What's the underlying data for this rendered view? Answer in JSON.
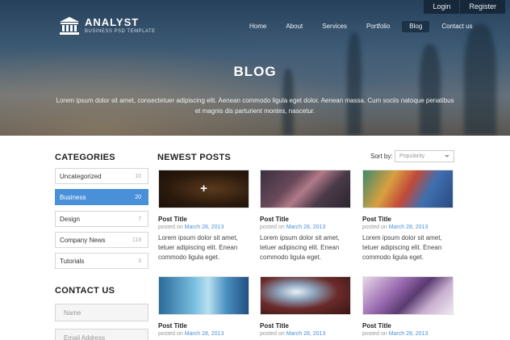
{
  "header": {
    "logo_title": "ANALYST",
    "logo_subtitle": "BUSINESS PSD TEMPLATE",
    "account_links": [
      "Login",
      "Register"
    ],
    "nav": [
      "Home",
      "About",
      "Services",
      "Portfolio",
      "Blog",
      "Contact us"
    ],
    "nav_active": "Blog",
    "hero_title": "BLOG",
    "hero_description": "Lorem ipsum dolor sit amet, consectetuer adipiscing elit. Aenean commodo ligula eget dolor. Aenean massa. Cum sociis natoque penatibus et magnis dis parturient montes, nascetur."
  },
  "sidebar": {
    "categories_heading": "CATEGORIES",
    "categories": [
      {
        "label": "Uncategorized",
        "count": "10",
        "active": false
      },
      {
        "label": "Business",
        "count": "20",
        "active": true
      },
      {
        "label": "Design",
        "count": "7",
        "active": false
      },
      {
        "label": "Company News",
        "count": "119",
        "active": false
      },
      {
        "label": "Tutorials",
        "count": "3",
        "active": false
      }
    ],
    "contact_heading": "CONTACT US",
    "contact_fields": [
      {
        "placeholder": "Name"
      },
      {
        "placeholder": "Email Address"
      }
    ]
  },
  "main": {
    "heading": "NEWEST POSTS",
    "sort_label": "Sort by:",
    "sort_value": "Popularity",
    "posts": [
      {
        "title": "Post Title",
        "meta_prefix": "posted on",
        "date": "March 28, 2013",
        "excerpt": "Lorem ipsum dolor sit amet, tetuer adipiscing elit. Enean commodo ligula eget.",
        "hover_icon": "+"
      },
      {
        "title": "Post Title",
        "meta_prefix": "posted on",
        "date": "March 28, 2013",
        "excerpt": "Lorem ipsum dolor sit amet, tetuer adipiscing elit. Enean commodo ligula eget."
      },
      {
        "title": "Post Title",
        "meta_prefix": "posted on",
        "date": "March 28, 2013",
        "excerpt": "Lorem ipsum dolor sit amet, tetuer adipiscing elit. Enean commodo ligula eget."
      },
      {
        "title": "Post Title",
        "meta_prefix": "posted on",
        "date": "March 28, 2013",
        "excerpt": ""
      },
      {
        "title": "Post Title",
        "meta_prefix": "posted on",
        "date": "March 28, 2013",
        "excerpt": ""
      },
      {
        "title": "Post Title",
        "meta_prefix": "posted on",
        "date": "March 28, 2013",
        "excerpt": ""
      }
    ]
  },
  "colors": {
    "accent": "#4a90d9",
    "topbar": "#16283a",
    "nav_active_bg": "#1d3247"
  }
}
